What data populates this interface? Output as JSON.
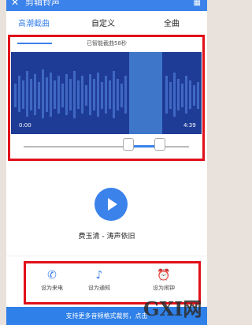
{
  "header": {
    "back_icon": "back-arrow-icon",
    "title": "剪辑铃声",
    "grid_icon": "grid-icon"
  },
  "tabs": [
    {
      "label": "高潮截曲"
    },
    {
      "label": "自定义"
    },
    {
      "label": "全曲"
    }
  ],
  "waveform": {
    "hint": "已智能截曲58秒",
    "start_time": "0:00",
    "end_time": "4:39"
  },
  "player": {
    "play_icon": "play-icon"
  },
  "song": {
    "title": "费玉清 - 涛声依旧"
  },
  "actions": [
    {
      "label": "设为来电",
      "icon": "phone-icon"
    },
    {
      "label": "设为通知",
      "icon": "notification-icon"
    },
    {
      "label": "设为闹钟",
      "icon": "alarm-icon"
    }
  ],
  "bottom_bar": {
    "text": "支持更多音频格式裁剪，点击"
  },
  "watermark": {
    "text": "GXI网"
  },
  "colors": {
    "accent": "#3b82ea",
    "annotation": "#e0101a",
    "wave_bg": "#1e3c96"
  }
}
